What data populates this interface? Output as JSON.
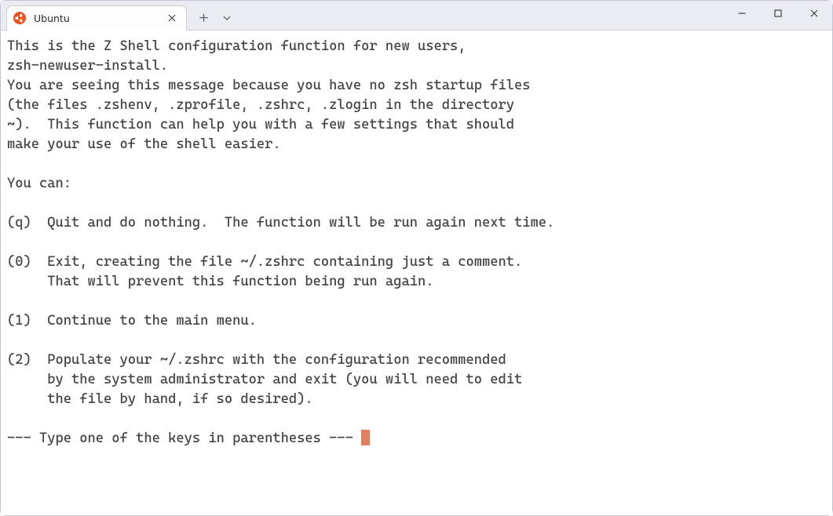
{
  "tab": {
    "title": "Ubuntu",
    "icon_bg": "#e95420"
  },
  "terminal": {
    "lines": [
      "This is the Z Shell configuration function for new users,",
      "zsh-newuser-install.",
      "You are seeing this message because you have no zsh startup files",
      "(the files .zshenv, .zprofile, .zshrc, .zlogin in the directory",
      "~).  This function can help you with a few settings that should",
      "make your use of the shell easier.",
      "",
      "You can:",
      "",
      "(q)  Quit and do nothing.  The function will be run again next time.",
      "",
      "(0)  Exit, creating the file ~/.zshrc containing just a comment.",
      "     That will prevent this function being run again.",
      "",
      "(1)  Continue to the main menu.",
      "",
      "(2)  Populate your ~/.zshrc with the configuration recommended",
      "     by the system administrator and exit (you will need to edit",
      "     the file by hand, if so desired).",
      ""
    ],
    "prompt": "--- Type one of the keys in parentheses --- "
  }
}
